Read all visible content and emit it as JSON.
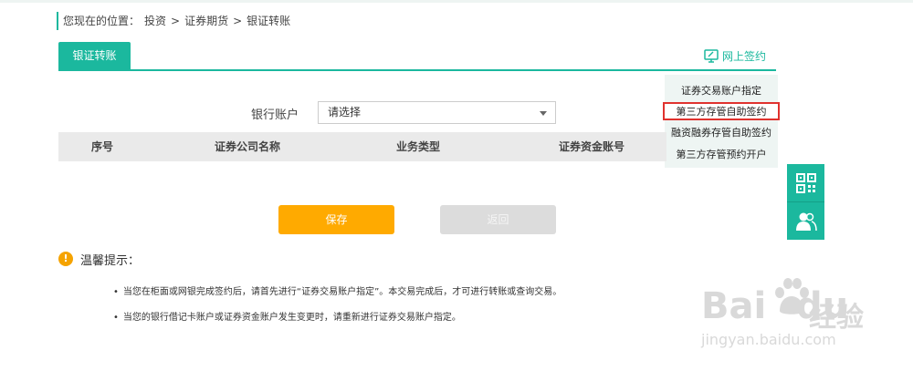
{
  "breadcrumb": {
    "prefix": "您现在的位置：",
    "items": [
      "投资",
      "证券期货",
      "银证转账"
    ],
    "separator": ">"
  },
  "tab": {
    "label": "银证转账"
  },
  "online_sign": {
    "label": "网上签约",
    "icon": "monitor-sign-icon"
  },
  "dropdown": {
    "items": [
      "证券交易账户指定",
      "第三方存管自助签约",
      "融资融券存管自助签约",
      "第三方存管预约开户"
    ],
    "highlighted_index": 1
  },
  "form": {
    "bank_account_label": "银行账户",
    "select_value": "请选择"
  },
  "table": {
    "headers": [
      "序号",
      "证券公司名称",
      "业务类型",
      "证券资金账号"
    ]
  },
  "buttons": {
    "save": "保存",
    "back": "返回"
  },
  "side_tools": [
    "qrcode-icon",
    "service-icon"
  ],
  "tips": {
    "title": "温馨提示：",
    "items": [
      "当您在柜面或网银完成签约后，请首先进行“证券交易账户指定”。本交易完成后，才可进行转账或查询交易。",
      "当您的银行借记卡账户或证券资金账户发生变更时，请重新进行证券交易账户指定。"
    ]
  },
  "watermark": {
    "brand": "Bai",
    "brand2": "du",
    "cn": "经验",
    "url": "jingyan.baidu.com"
  },
  "colors": {
    "accent": "#1bb89e",
    "save": "#ffaa00",
    "highlight_border": "#e0322e"
  }
}
